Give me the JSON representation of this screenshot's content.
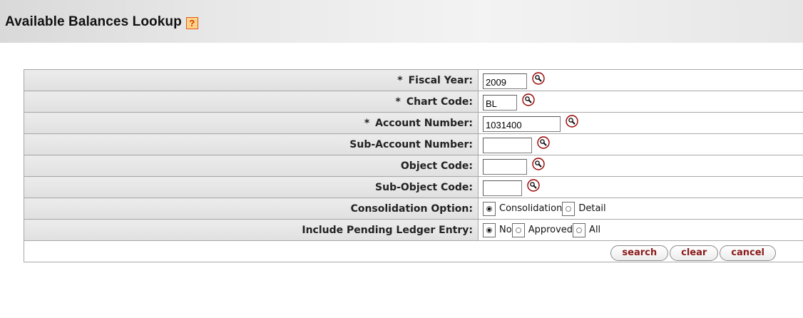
{
  "header": {
    "title": "Available Balances Lookup",
    "help_icon": "help-icon"
  },
  "fields": [
    {
      "label": "Fiscal Year:",
      "required": "*",
      "value": "2009",
      "lookup_icon": "magnifier-icon"
    },
    {
      "label": "Chart Code:",
      "required": "*",
      "value": "BL",
      "lookup_icon": "magnifier-icon"
    },
    {
      "label": "Account Number:",
      "required": "*",
      "value": "1031400",
      "lookup_icon": "magnifier-icon"
    },
    {
      "label": "Sub-Account Number:",
      "value": "",
      "lookup_icon": "magnifier-icon"
    },
    {
      "label": "Object Code:",
      "value": "",
      "lookup_icon": "magnifier-icon"
    },
    {
      "label": "Sub-Object Code:",
      "value": "",
      "lookup_icon": "magnifier-icon"
    }
  ],
  "consolidation": {
    "label": "Consolidation Option:",
    "options": [
      "Consolidation",
      "Detail"
    ],
    "selected": "Consolidation"
  },
  "pending": {
    "label": "Include Pending Ledger Entry:",
    "options": [
      "No",
      "Approved",
      "All"
    ],
    "selected": "No"
  },
  "buttons": {
    "search": "search",
    "clear": "clear",
    "cancel": "cancel"
  },
  "colors": {
    "button_text": "#8b1a1a",
    "help_icon_bg": "#ffd38a",
    "help_icon_border": "#e05a1a"
  }
}
